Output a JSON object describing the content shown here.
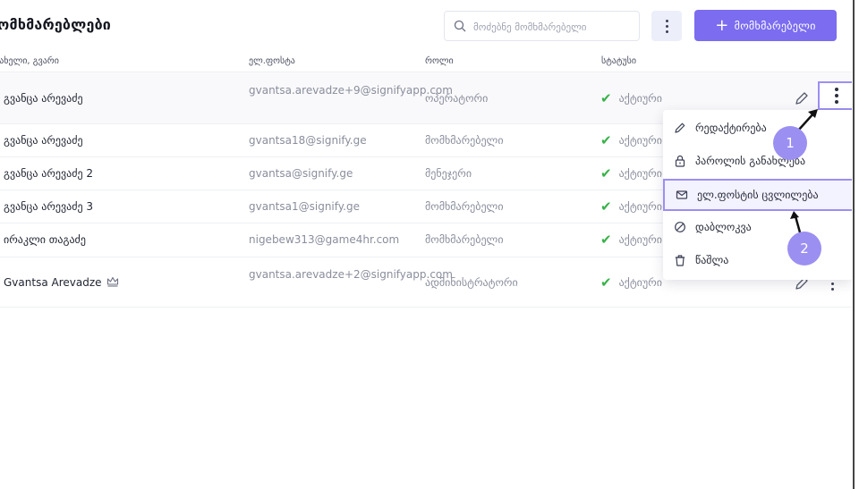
{
  "header": {
    "title": "მომხმარებლები",
    "search_placeholder": "მოძებნე მომხმარებელი",
    "add_button_label": "მომხმარებელი"
  },
  "table": {
    "columns": [
      "სახელი, გვარი",
      "ელ.ფოსტა",
      "როლი",
      "სტატუსი"
    ],
    "rows": [
      {
        "name": "გვანცა არევაძე",
        "email": "gvantsa.arevadze+9@signifyapp.com",
        "role": "ოპერატორი",
        "status": "აქტიური"
      },
      {
        "name": "გვანცა არევაძე",
        "email": "gvantsa18@signify.ge",
        "role": "მომხმარებელი",
        "status": "აქტიური"
      },
      {
        "name": "გვანცა არევაძე 2",
        "email": "gvantsa@signify.ge",
        "role": "მენეჯერი",
        "status": "აქტიური"
      },
      {
        "name": "გვანცა არევაძე 3",
        "email": "gvantsa1@signify.ge",
        "role": "მომხმარებელი",
        "status": "აქტიური"
      },
      {
        "name": "ირაკლი თაგაძე",
        "email": "nigebew313@game4hr.com",
        "role": "მომხმარებელი",
        "status": "აქტიური"
      },
      {
        "name": "Gvantsa Arevadze",
        "email": "gvantsa.arevadze+2@signifyapp.com",
        "role": "ადმინისტრატორი",
        "status": "აქტიური"
      }
    ]
  },
  "context_menu": {
    "items": [
      "რედაქტირება",
      "პაროლის განახლება",
      "ელ.ფოსტის ცვლილება",
      "დაბლოკვა",
      "წაშლა"
    ],
    "selected_index": 2
  },
  "annotations": {
    "step1": "1",
    "step2": "2"
  },
  "colors": {
    "accent": "#7b6cf0",
    "highlight": "#9b8ff2",
    "active": "#38b24a"
  }
}
